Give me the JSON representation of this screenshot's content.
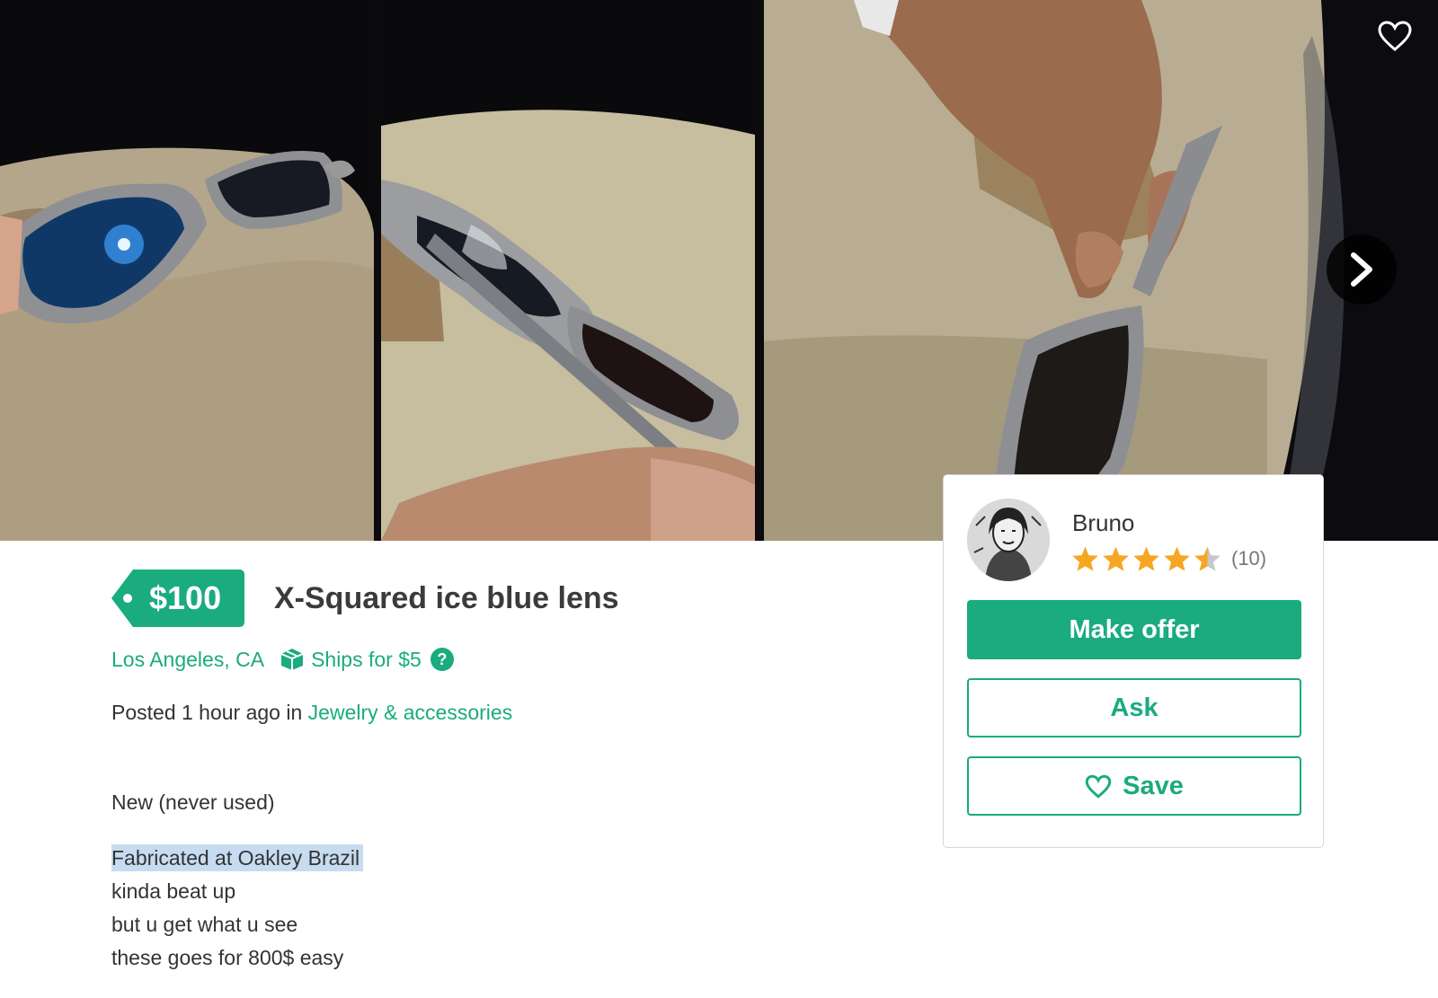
{
  "listing": {
    "price": "$100",
    "title": "X-Squared ice blue lens",
    "location": "Los Angeles, CA",
    "shipping": "Ships for $5",
    "help_icon": "?",
    "posted_prefix": "Posted 1 hour ago in ",
    "category": "Jewelry & accessories",
    "description": [
      "New (never used)",
      "Fabricated at Oakley Brazil",
      "kinda beat up",
      "but u get what u see",
      "these goes for 800$ easy"
    ]
  },
  "seller": {
    "name": "Bruno",
    "rating": 4.5,
    "review_count": "(10)"
  },
  "actions": {
    "make_offer": "Make offer",
    "ask": "Ask",
    "save": "Save"
  },
  "gallery": {
    "favorite_icon": "heart-outline-icon",
    "next_icon": "chevron-right-icon"
  },
  "colors": {
    "brand": "#1aab7f",
    "star": "#f5a623",
    "star_empty": "#c8c8c8",
    "highlight": "#c7dcf1"
  }
}
